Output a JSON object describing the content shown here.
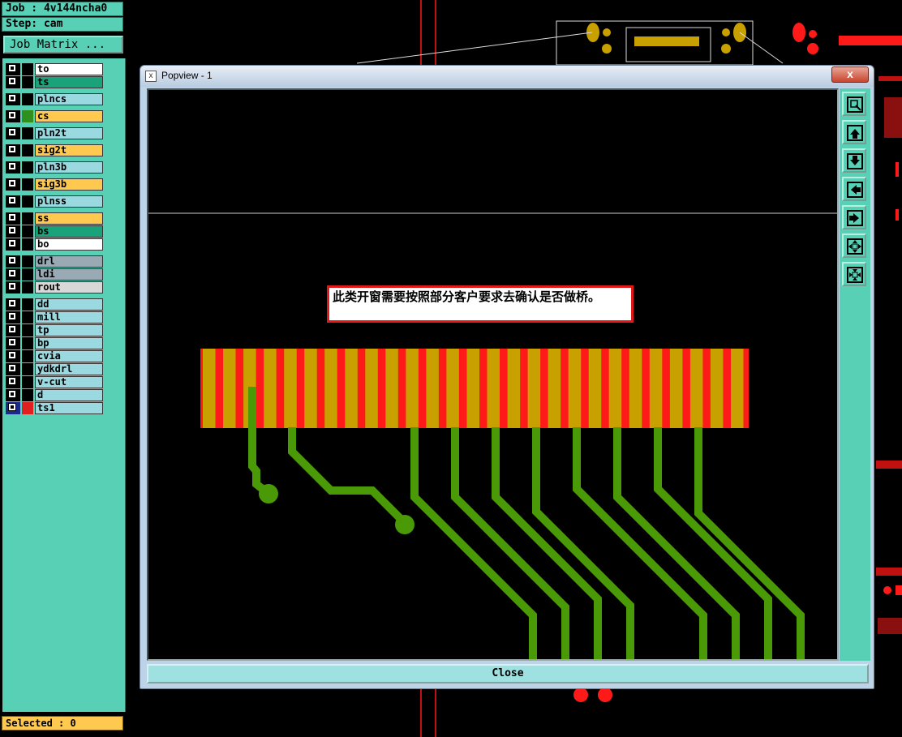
{
  "left_panel": {
    "job_label": "Job : 4v144ncha0",
    "step_label": "Step: cam",
    "job_matrix_button": "Job Matrix ...",
    "selected_label": "Selected : 0",
    "layers": [
      {
        "name": "to",
        "color": "#ffffff"
      },
      {
        "name": "ts",
        "color": "#1aa37a"
      },
      {
        "name": "plncs",
        "color": "#9ad9e0"
      },
      {
        "name": "cs",
        "color": "#ffc84f",
        "swatch": "#2f8f1f"
      },
      {
        "name": "pln2t",
        "color": "#9ad9e0"
      },
      {
        "name": "sig2t",
        "color": "#ffc84f"
      },
      {
        "name": "pln3b",
        "color": "#9ad9e0"
      },
      {
        "name": "sig3b",
        "color": "#ffc84f"
      },
      {
        "name": "plnss",
        "color": "#9ad9e0"
      },
      {
        "name": "ss",
        "color": "#ffc84f"
      },
      {
        "name": "bs",
        "color": "#1aa37a"
      },
      {
        "name": "bo",
        "color": "#ffffff"
      },
      {
        "name": "drl",
        "color": "#9aaab5"
      },
      {
        "name": "ldi",
        "color": "#9aaab5"
      },
      {
        "name": "rout",
        "color": "#d8d8d8"
      },
      {
        "name": "dd",
        "color": "#9ad9e0"
      },
      {
        "name": "mill",
        "color": "#9ad9e0"
      },
      {
        "name": "tp",
        "color": "#9ad9e0"
      },
      {
        "name": "bp",
        "color": "#9ad9e0"
      },
      {
        "name": "cvia",
        "color": "#9ad9e0"
      },
      {
        "name": "ydkdrl",
        "color": "#9ad9e0"
      },
      {
        "name": "v-cut",
        "color": "#9ad9e0"
      },
      {
        "name": "d",
        "color": "#9ad9e0"
      },
      {
        "name": "ts1",
        "color": "#9ad9e0",
        "swatch": "#e02020",
        "active": true
      }
    ]
  },
  "popup": {
    "title": "Popview - 1",
    "close_x": "x",
    "close_button": "Close",
    "note_text": "此类开窗需要按照部分客户要求去确认是否做桥。",
    "tools": [
      "zoom-fit-icon",
      "pan-up-icon",
      "pan-down-icon",
      "pan-left-icon",
      "pan-right-icon",
      "zoom-in-icon",
      "zoom-out-icon"
    ]
  },
  "colors": {
    "panel_teal": "#57d0b5",
    "pad_gold": "#c8a000",
    "pad_red": "#ff1a1a",
    "trace_green": "#4a9a08"
  }
}
